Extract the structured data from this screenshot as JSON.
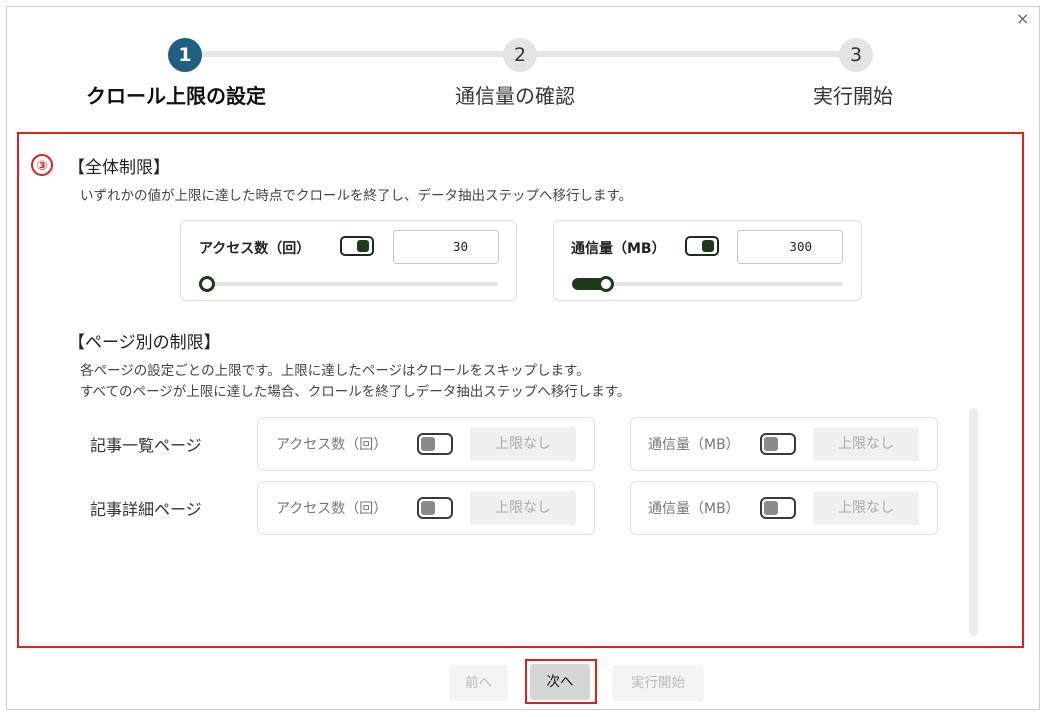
{
  "dialog": {
    "close_glyph": "×"
  },
  "stepper": {
    "steps": [
      {
        "number": "1",
        "label": "クロール上限の設定"
      },
      {
        "number": "2",
        "label": "通信量の確認"
      },
      {
        "number": "3",
        "label": "実行開始"
      }
    ]
  },
  "annotation": {
    "marker": "③"
  },
  "overall": {
    "title": "【全体制限】",
    "description": "いずれかの値が上限に達した時点でクロールを終了し、データ抽出ステップへ移行します。",
    "access": {
      "label": "アクセス数（回）",
      "value": "30",
      "toggle_on": true,
      "slider_fraction": 0.0
    },
    "traffic": {
      "label": "通信量（MB）",
      "value": "300",
      "toggle_on": true,
      "slider_fraction": 0.1
    }
  },
  "per_page": {
    "title": "【ページ別の制限】",
    "description_line1": "各ページの設定ごとの上限です。上限に達したページはクロールをスキップします。",
    "description_line2": "すべてのページが上限に達した場合、クロールを終了しデータ抽出ステップへ移行します。",
    "rows": [
      {
        "label": "記事一覧ページ",
        "access_label": "アクセス数（回）",
        "access_placeholder": "上限なし",
        "traffic_label": "通信量（MB）",
        "traffic_placeholder": "上限なし"
      },
      {
        "label": "記事詳細ページ",
        "access_label": "アクセス数（回）",
        "access_placeholder": "上限なし",
        "traffic_label": "通信量（MB）",
        "traffic_placeholder": "上限なし"
      }
    ]
  },
  "footer": {
    "prev_label": "前へ",
    "next_label": "次へ",
    "run_label": "実行開始"
  },
  "colors": {
    "accent": "#1f5f84",
    "toggle_dark": "#1d3a1d",
    "highlight_red": "#e02020"
  }
}
